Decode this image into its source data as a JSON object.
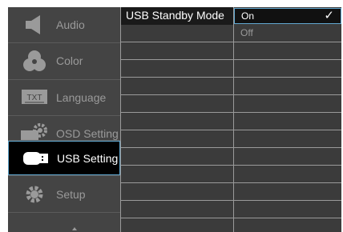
{
  "sidebar": {
    "items": [
      {
        "label": "Audio",
        "icon": "speaker-icon",
        "active": false
      },
      {
        "label": "Color",
        "icon": "color-circles-icon",
        "active": false
      },
      {
        "label": "Language",
        "icon": "txt-language-icon",
        "active": false
      },
      {
        "label": "OSD Setting",
        "icon": "osd-gear-icon",
        "active": false
      },
      {
        "label": "USB Setting",
        "icon": "usb-icon",
        "active": true
      },
      {
        "label": "Setup",
        "icon": "setup-gear-icon",
        "active": false
      }
    ],
    "scroll_indicator": "up-arrow-icon"
  },
  "settings": {
    "items": [
      {
        "label": "USB Standby Mode",
        "active": true
      }
    ]
  },
  "values": {
    "options": [
      {
        "label": "On",
        "selected": true
      },
      {
        "label": "Off",
        "selected": false
      }
    ],
    "check_glyph": "✓"
  },
  "colors": {
    "accent_border": "#62a8d0",
    "panel_bg": "#3b3b3b",
    "sidebar_bg": "#444444"
  }
}
